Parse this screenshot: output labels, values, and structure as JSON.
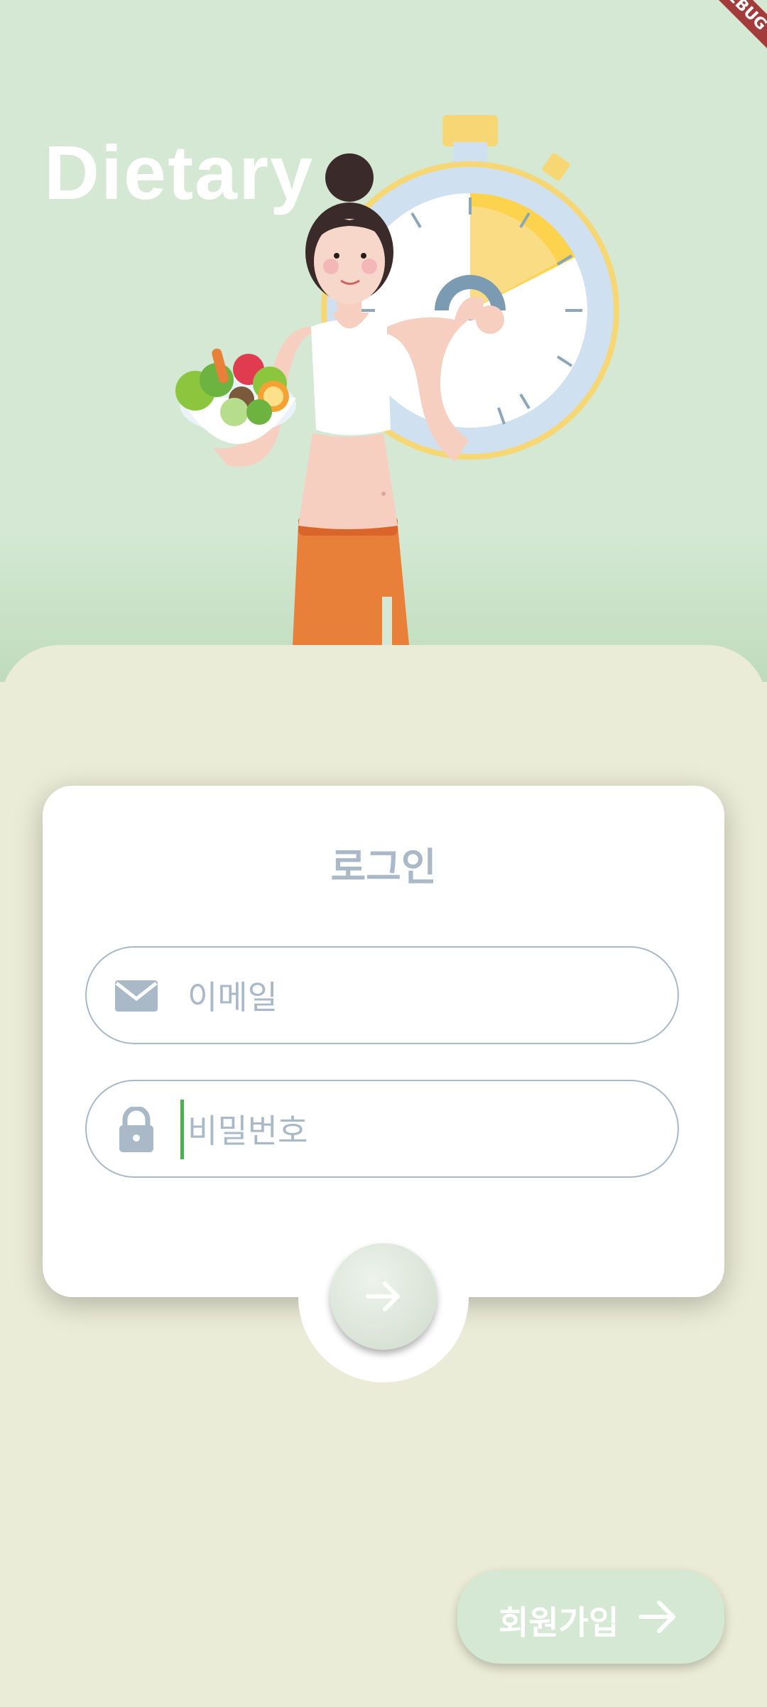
{
  "app": {
    "title": "Dietary",
    "debug_banner": "DEBUG"
  },
  "login": {
    "heading": "로그인",
    "email": {
      "placeholder": "이메일",
      "value": ""
    },
    "password": {
      "placeholder": "비밀번호",
      "value": ""
    }
  },
  "signup": {
    "label": "회원가입"
  },
  "colors": {
    "hero_background": "#d4e8d3",
    "sheet_background": "#ebecd7",
    "card_background": "#ffffff",
    "muted_text": "#a9b9c8",
    "cursor": "#4caf50",
    "ribbon": "#a33b3b"
  },
  "icons": {
    "email": "envelope-icon",
    "password": "lock-icon",
    "submit": "arrow-right-icon",
    "signup": "arrow-right-icon"
  }
}
